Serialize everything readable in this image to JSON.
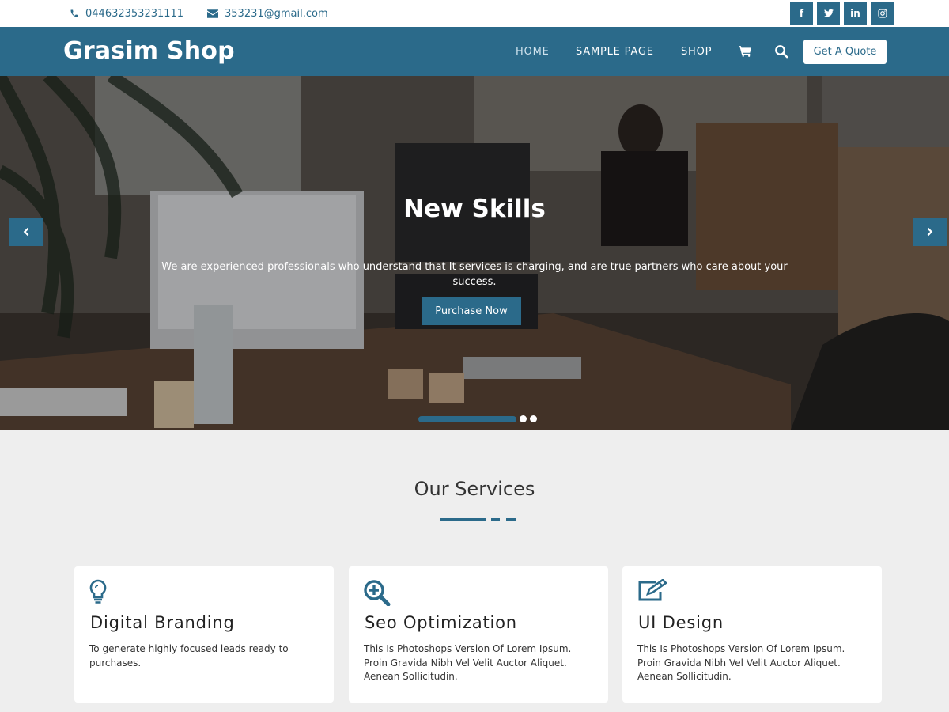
{
  "topbar": {
    "phone": "044632353231111",
    "email": "353231@gmail.com",
    "social": [
      {
        "icon": "facebook-icon",
        "glyph": "f"
      },
      {
        "icon": "twitter-icon",
        "glyph": "t"
      },
      {
        "icon": "linkedin-icon",
        "glyph": "in"
      },
      {
        "icon": "instagram-icon",
        "glyph": "◎"
      }
    ]
  },
  "header": {
    "logo": "Grasim Shop",
    "nav": {
      "home": "HOME",
      "sample_page": "SAMPLE PAGE",
      "shop": "SHOP"
    },
    "quote_button": "Get A Quote"
  },
  "hero": {
    "title": "New Skills",
    "text": "We are experienced professionals who understand that It services is charging, and are true partners who care about your success.",
    "button": "Purchase Now"
  },
  "services": {
    "title": "Our Services",
    "cards": [
      {
        "icon": "lightbulb-icon",
        "title": "Digital Branding",
        "text": "To generate highly focused leads ready to purchases."
      },
      {
        "icon": "search-plus-icon",
        "title": "Seo Optimization",
        "text": "This Is Photoshops Version Of Lorem Ipsum. Proin Gravida Nibh Vel Velit Auctor Aliquet. Aenean Sollicitudin."
      },
      {
        "icon": "edit-icon",
        "title": "UI Design",
        "text": "This Is Photoshops Version Of Lorem Ipsum. Proin Gravida Nibh Vel Velit Auctor Aliquet. Aenean Sollicitudin."
      }
    ]
  },
  "colors": {
    "primary": "#2b6a8a",
    "background": "#eeeeee"
  }
}
